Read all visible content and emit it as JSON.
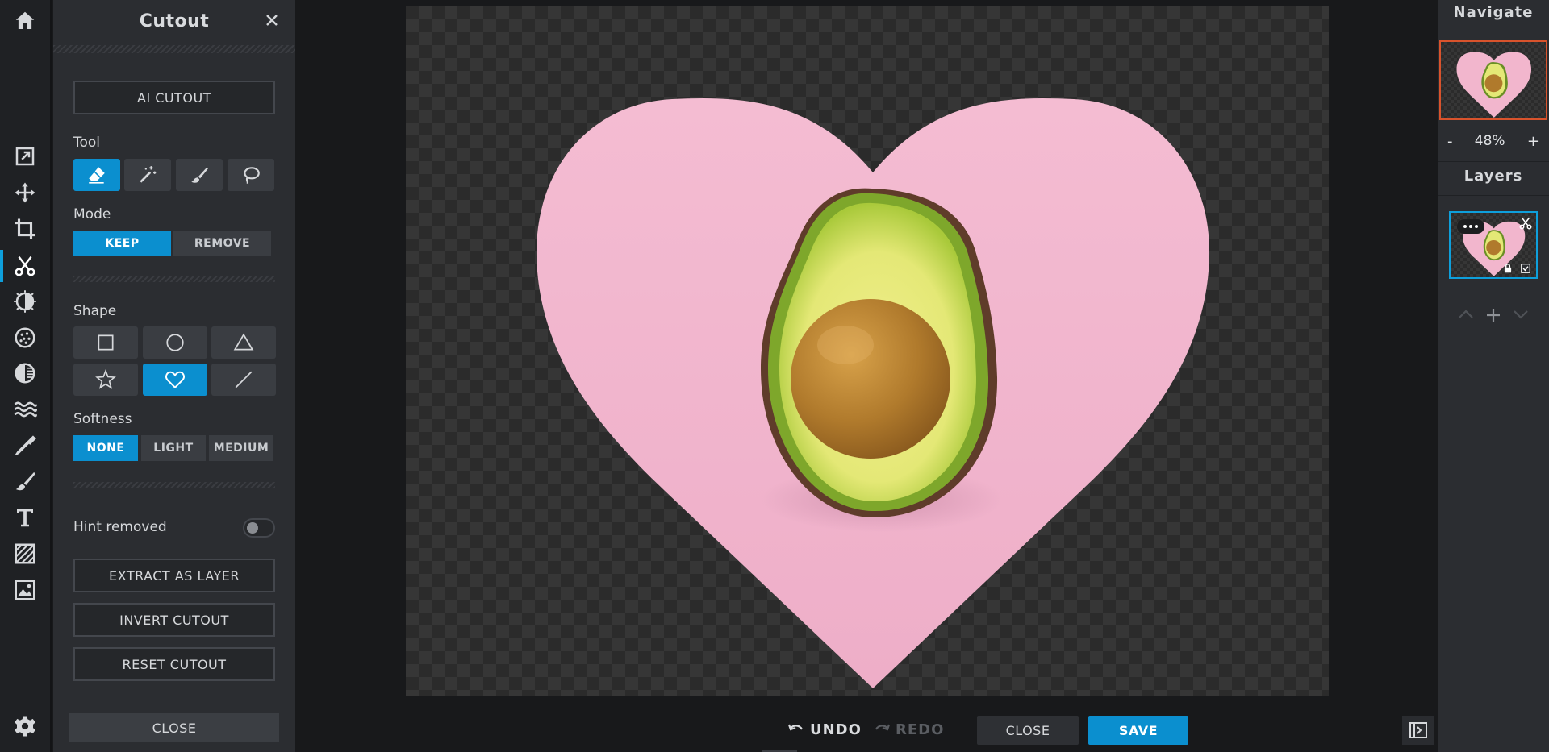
{
  "panel": {
    "title": "Cutout",
    "ai_cutout": "AI CUTOUT",
    "tool_label": "Tool",
    "tools": [
      "eraser",
      "magic-wand",
      "brush",
      "lasso"
    ],
    "active_tool": "eraser",
    "mode_label": "Mode",
    "modes": [
      "KEEP",
      "REMOVE"
    ],
    "active_mode": "KEEP",
    "shape_label": "Shape",
    "shapes": [
      "square",
      "circle",
      "triangle",
      "star",
      "heart",
      "line"
    ],
    "active_shape": "heart",
    "softness_label": "Softness",
    "softness": [
      "NONE",
      "LIGHT",
      "MEDIUM"
    ],
    "active_softness": "NONE",
    "hint_label": "Hint removed",
    "hint_on": false,
    "extract": "EXTRACT AS LAYER",
    "invert": "INVERT CUTOUT",
    "reset": "RESET CUTOUT",
    "close": "CLOSE"
  },
  "bottom": {
    "undo": "UNDO",
    "redo": "REDO",
    "close": "CLOSE",
    "save": "SAVE"
  },
  "right": {
    "navigate": "Navigate",
    "zoom_minus": "-",
    "zoom_value": "48%",
    "zoom_plus": "+",
    "layers": "Layers"
  },
  "colors": {
    "accent": "#0b8fcf",
    "heart": "#f2b6cd",
    "nav_border": "#d9532c"
  }
}
